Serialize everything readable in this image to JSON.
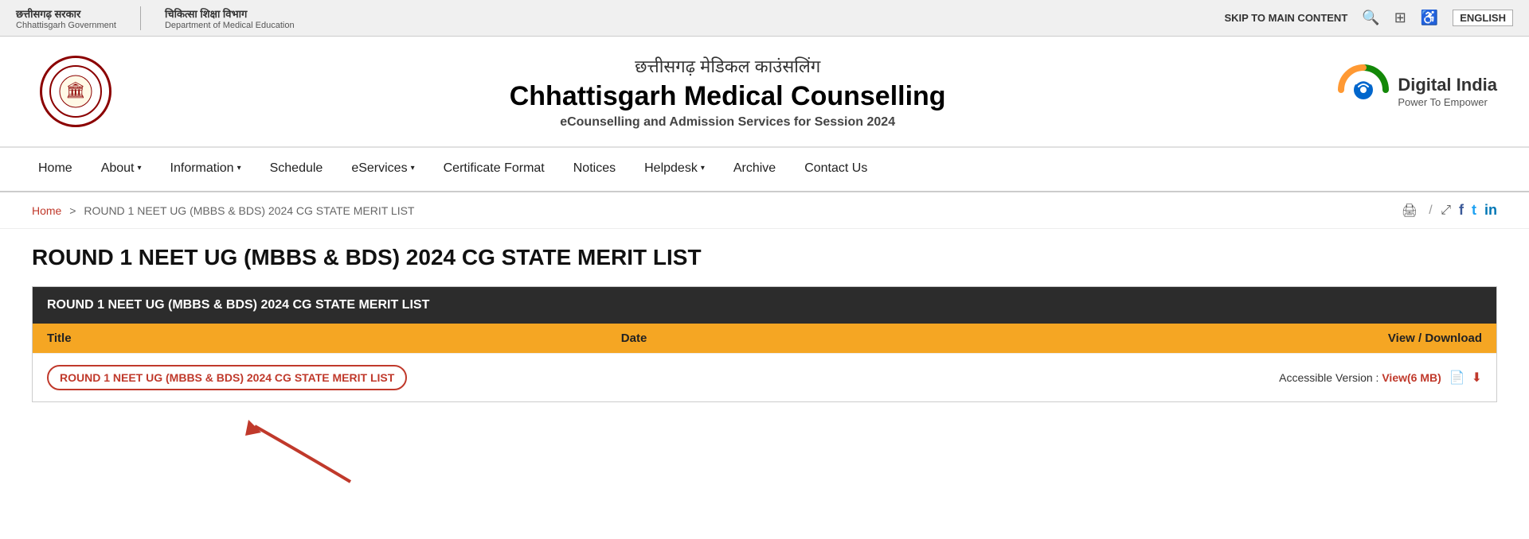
{
  "topbar": {
    "gov1_line1": "छत्तीसगढ़ सरकार",
    "gov1_line2": "Chhattisgarh Government",
    "gov2_line1": "चिकित्सा शिक्षा विभाग",
    "gov2_line2": "Department of Medical Education",
    "skip_label": "SKIP TO MAIN CONTENT",
    "lang_label": "ENGLISH"
  },
  "header": {
    "hindi_title": "छत्तीसगढ़ मेडिकल काउंसलिंग",
    "main_title": "Chhattisgarh Medical Counselling",
    "subtitle": "eCounselling and Admission Services for Session 2024",
    "digital_india_line1": "Digital India",
    "digital_india_line2": "Power To Empower"
  },
  "nav": {
    "items": [
      {
        "label": "Home",
        "has_chevron": false
      },
      {
        "label": "About",
        "has_chevron": true
      },
      {
        "label": "Information",
        "has_chevron": true
      },
      {
        "label": "Schedule",
        "has_chevron": false
      },
      {
        "label": "eServices",
        "has_chevron": true
      },
      {
        "label": "Certificate Format",
        "has_chevron": false
      },
      {
        "label": "Notices",
        "has_chevron": false
      },
      {
        "label": "Helpdesk",
        "has_chevron": true
      },
      {
        "label": "Archive",
        "has_chevron": false
      },
      {
        "label": "Contact Us",
        "has_chevron": false
      }
    ]
  },
  "breadcrumb": {
    "home": "Home",
    "separator": ">",
    "current": "ROUND 1 NEET UG (MBBS & BDS) 2024 CG STATE MERIT LIST"
  },
  "page": {
    "title": "ROUND 1 NEET UG (MBBS & BDS) 2024 CG STATE MERIT LIST",
    "table_header": "ROUND 1 NEET UG (MBBS & BDS) 2024 CG STATE MERIT LIST",
    "col_title": "Title",
    "col_date": "Date",
    "col_download": "View / Download",
    "row_title": "ROUND 1 NEET UG (MBBS & BDS) 2024 CG STATE MERIT LIST",
    "row_date": "",
    "accessible_label": "Accessible Version :",
    "view_link": "View(6 MB)"
  }
}
